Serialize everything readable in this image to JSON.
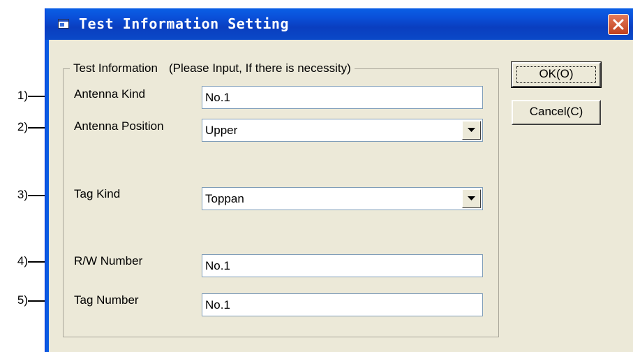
{
  "window": {
    "title": "Test Information Setting"
  },
  "group": {
    "legend": "Test Information",
    "hint": "(Please Input, If there is necessity)"
  },
  "fields": {
    "antenna_kind": {
      "label": "Antenna Kind",
      "value": "No.1"
    },
    "antenna_position": {
      "label": "Antenna Position",
      "value": "Upper"
    },
    "tag_kind": {
      "label": "Tag Kind",
      "value": "Toppan"
    },
    "rw_number": {
      "label": "R/W Number",
      "value": "No.1"
    },
    "tag_number": {
      "label": "Tag Number",
      "value": "No.1"
    }
  },
  "buttons": {
    "ok": "OK(O)",
    "cancel": "Cancel(C)"
  },
  "callouts": [
    "1)",
    "2)",
    "3)",
    "4)",
    "5)"
  ],
  "icons": {
    "app": "window-icon",
    "close": "close-icon",
    "dropdown": "dropdown-arrow-icon"
  }
}
